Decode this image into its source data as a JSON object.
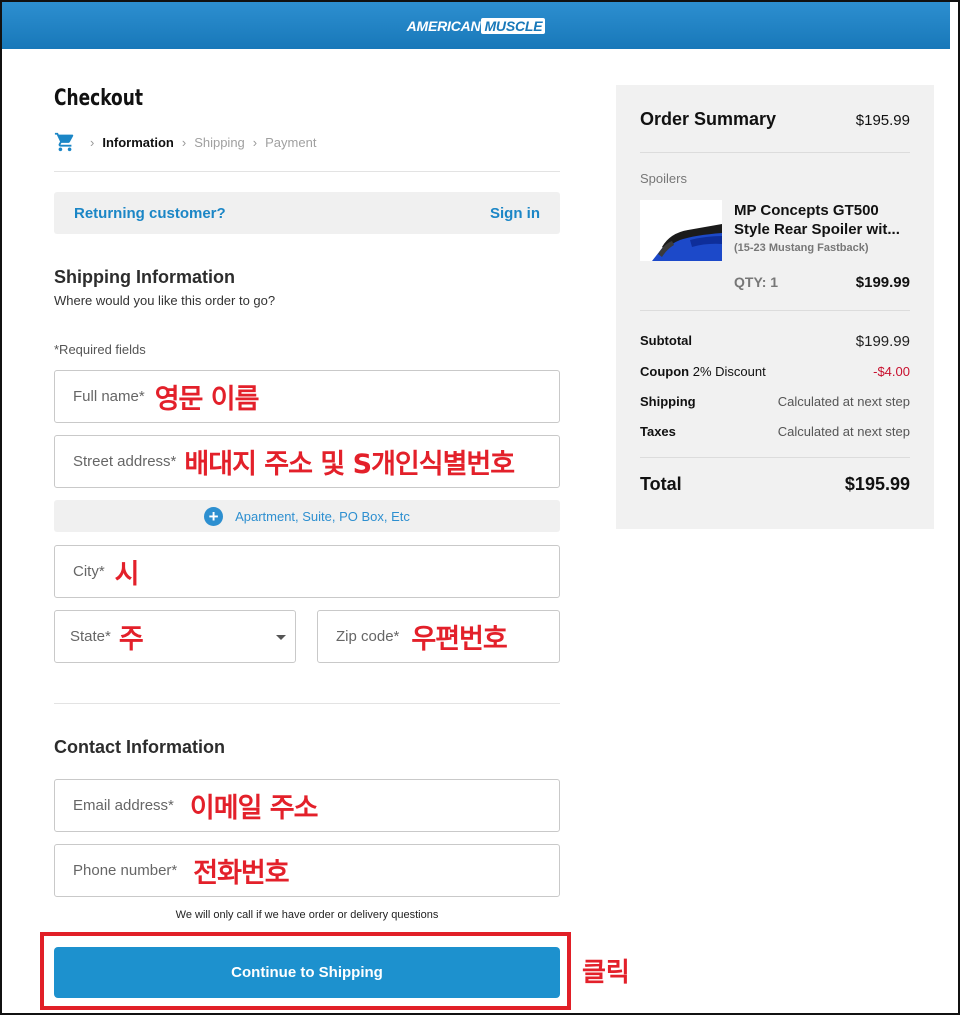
{
  "header": {
    "logo_american": "AMERICAN",
    "logo_muscle": "MUSCLE"
  },
  "checkout": {
    "title": "Checkout",
    "breadcrumb": {
      "information": "Information",
      "shipping": "Shipping",
      "payment": "Payment"
    }
  },
  "returning": {
    "label": "Returning customer?",
    "signin": "Sign in"
  },
  "shipping_info": {
    "title": "Shipping Information",
    "subtitle": "Where would you like this order to go?",
    "required_note": "*Required fields",
    "fields": {
      "full_name": {
        "placeholder": "Full name*",
        "annotation": "영문 이름"
      },
      "street": {
        "placeholder": "Street address*",
        "annotation": "배대지 주소 및 S개인식별번호"
      },
      "apartment": "Apartment, Suite, PO Box, Etc",
      "city": {
        "placeholder": "City*",
        "annotation": "시"
      },
      "state": {
        "placeholder": "State*",
        "annotation": "주"
      },
      "zip": {
        "placeholder": "Zip code*",
        "annotation": "우편번호"
      }
    }
  },
  "contact_info": {
    "title": "Contact Information",
    "email": {
      "placeholder": "Email address*",
      "annotation": "이메일 주소"
    },
    "phone": {
      "placeholder": "Phone number*",
      "annotation": "전화번호"
    },
    "call_note": "We will only call if we have order or delivery questions"
  },
  "continue_button": "Continue to Shipping",
  "click_annotation": "클릭",
  "summary": {
    "title": "Order Summary",
    "header_total": "$195.99",
    "category": "Spoilers",
    "product_name_line1": "MP Concepts GT500",
    "product_name_line2": "Style Rear Spoiler wit...",
    "product_fitment": "(15-23 Mustang Fastback)",
    "qty_label": "QTY: 1",
    "qty_price": "$199.99",
    "subtotal_label": "Subtotal",
    "subtotal_value": "$199.99",
    "coupon_label": "Coupon",
    "coupon_desc": "2% Discount",
    "coupon_value": "-$4.00",
    "shipping_label": "Shipping",
    "shipping_value": "Calculated at next step",
    "taxes_label": "Taxes",
    "taxes_value": "Calculated at next step",
    "total_label": "Total",
    "total_value": "$195.99"
  },
  "colors": {
    "brand_blue": "#1878b9",
    "button_blue": "#1d91ce",
    "annotation_red": "#e3202a"
  },
  "icons": [
    "cart-icon",
    "chevron-right-icon",
    "plus-circle-icon",
    "caret-down-icon"
  ]
}
